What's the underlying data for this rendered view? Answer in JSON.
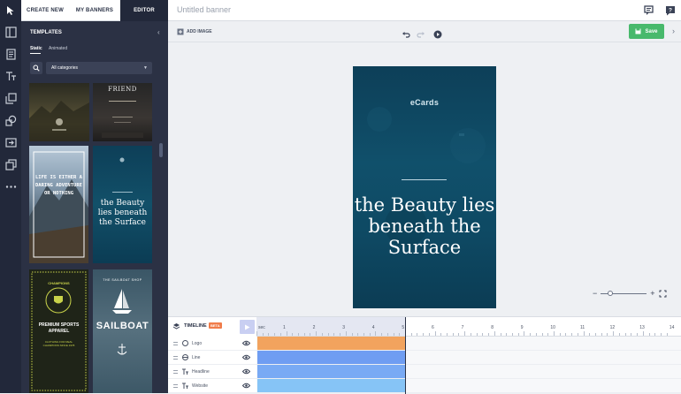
{
  "topbar": {
    "tabs": [
      {
        "label": "CREATE NEW",
        "active": false
      },
      {
        "label": "MY BANNERS",
        "active": false
      },
      {
        "label": "EDITOR",
        "active": true
      }
    ],
    "banner_title": "Untitled banner",
    "icons": [
      "chat-icon",
      "help-icon"
    ]
  },
  "rail": {
    "icons": [
      "layout-icon",
      "template-icon",
      "text-icon",
      "images-icon",
      "shapes-icon",
      "import-icon",
      "duplicate-icon",
      "more-icon"
    ]
  },
  "panel": {
    "title": "TEMPLATES",
    "tabs": [
      {
        "label": "Static",
        "active": true
      },
      {
        "label": "Animated",
        "active": false
      }
    ],
    "category": "All categories",
    "templates": [
      {
        "id": "t1",
        "text": ""
      },
      {
        "id": "t2",
        "text": "FRIEND"
      },
      {
        "id": "t3",
        "text": "LIFE IS EITHER A DARING ADVENTURE OR NOTHING"
      },
      {
        "id": "t4",
        "text": "the Beauty lies beneath the Surface"
      },
      {
        "id": "t5",
        "text": "CHAMPIONS",
        "sub1": "PREMIUM SPORTS APPAREL",
        "sub2": "CLOTHING FOR REAL CHAMPIONS SINCE 1978"
      },
      {
        "id": "t6",
        "text": "SAILBOAT",
        "sub1": "THE SAILBOAT SHOP"
      }
    ]
  },
  "toolbar": {
    "add_image": "ADD IMAGE",
    "save": "Save"
  },
  "banner": {
    "logo": "eCards",
    "headline": "the Beauty lies beneath the Surface"
  },
  "timeline": {
    "title": "TIMELINE",
    "beta": "BETA",
    "ruler_unit": "sec",
    "ruler_ticks": [
      "1",
      "2",
      "3",
      "4",
      "5",
      "6",
      "7",
      "8",
      "9",
      "10",
      "11",
      "12",
      "13",
      "14"
    ],
    "layers": [
      {
        "name": "Logo",
        "color": "#f2a35e"
      },
      {
        "name": "Line",
        "color": "#6f9df2"
      },
      {
        "name": "Headline",
        "color": "#79aaf4"
      },
      {
        "name": "Website",
        "color": "#86c4f6"
      }
    ]
  }
}
